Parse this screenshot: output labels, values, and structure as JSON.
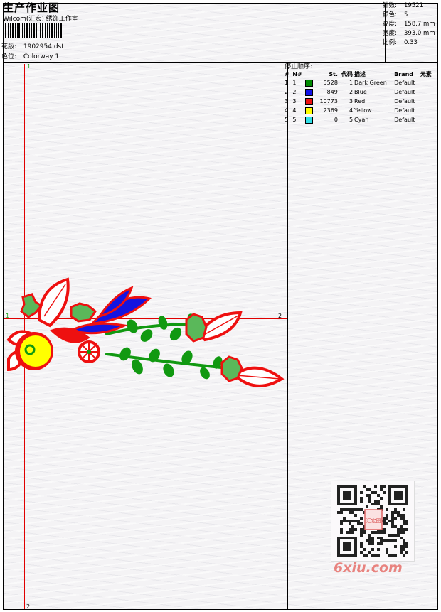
{
  "header": {
    "title": "生产作业图",
    "company": "Wilcom(汇宏) 绣饰工作室",
    "file_label": "花版:",
    "file_value": "1902954.dst",
    "colorway_label": "色位:",
    "colorway_value": "Colorway 1"
  },
  "stats": [
    {
      "label": "针数:",
      "value": "19521"
    },
    {
      "label": "颜色:",
      "value": "5"
    },
    {
      "label": "高度:",
      "value": "158.7 mm"
    },
    {
      "label": "宽度:",
      "value": "393.0 mm"
    },
    {
      "label": "比例:",
      "value": "0.33"
    }
  ],
  "sequence": {
    "title": "停止顺序:",
    "headers": [
      "#",
      "N#",
      "St.",
      "代码",
      "描述",
      "Brand",
      "元素"
    ],
    "rows": [
      {
        "idx": "1.",
        "n": "1",
        "stitches": "5528",
        "code": "1",
        "desc": "Dark Green",
        "brand": "Default",
        "color": "#008a00"
      },
      {
        "idx": "2.",
        "n": "2",
        "stitches": "849",
        "code": "2",
        "desc": "Blue",
        "brand": "Default",
        "color": "#1010e8"
      },
      {
        "idx": "3.",
        "n": "3",
        "stitches": "10773",
        "code": "3",
        "desc": "Red",
        "brand": "Default",
        "color": "#ee1010"
      },
      {
        "idx": "4.",
        "n": "4",
        "stitches": "2369",
        "code": "4",
        "desc": "Yellow",
        "brand": "Default",
        "color": "#ffff00"
      },
      {
        "idx": "5.",
        "n": "5",
        "stitches": "0",
        "code": "5",
        "desc": "Cyan",
        "brand": "Default",
        "color": "#30e0e8"
      }
    ]
  },
  "guides": {
    "top_label": "1",
    "bottom_label": "2",
    "left_label": "1",
    "right_label": "2"
  },
  "qr": {
    "stamp_text": "汇宏图",
    "watermark": "6xiu.com"
  },
  "colors": {
    "guide_line": "#e00000",
    "leaf_red": "#ee1010",
    "leaf_green": "#119911",
    "blue": "#1414e0",
    "yellow": "#ffff00"
  }
}
